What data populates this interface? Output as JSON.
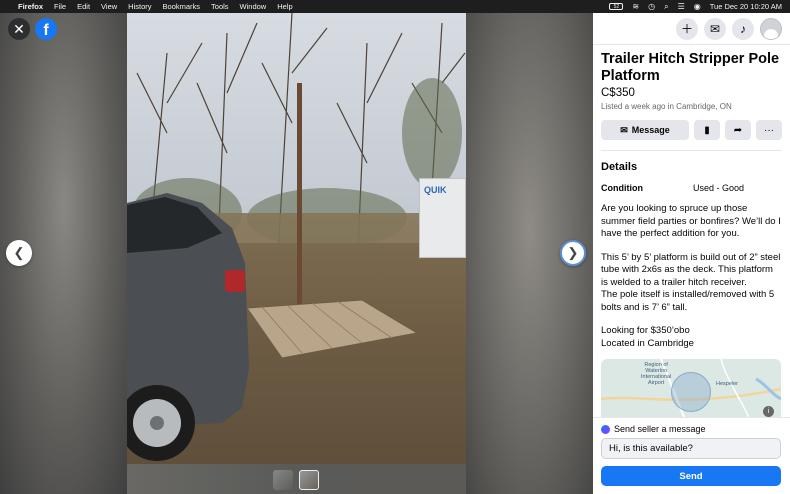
{
  "menubar": {
    "app": "Firefox",
    "menus": [
      "File",
      "Edit",
      "View",
      "History",
      "Bookmarks",
      "Tools",
      "Window",
      "Help"
    ],
    "battery": "52",
    "clock": "Tue Dec 20  10:20 AM"
  },
  "viewer": {
    "trailer_text": "QUIK",
    "thumb_count": 2,
    "active_thumb": 1
  },
  "listing": {
    "title": "Trailer Hitch Stripper Pole Platform",
    "price": "C$350",
    "listed": "Listed a week ago in Cambridge, ON",
    "message_button": "Message",
    "details_heading": "Details",
    "condition_label": "Condition",
    "condition_value": "Used - Good",
    "description": [
      "Are you looking to spruce up those summer field parties or bonfires? We’ll do I have the perfect addition for you.",
      "This 5’ by 5’ platform is build out of 2” steel tube with 2x6s as the deck. This platform is welded to a trailer hitch receiver.\nThe pole itself is installed/removed with 5 bolts and is 7’ 6” tall.",
      "Looking for $350’obo\nLocated in Cambridge"
    ]
  },
  "map": {
    "label_region": "Region of\nWaterloo\nInternational\nAirport",
    "label_town": "Hespeler"
  },
  "send": {
    "title": "Send seller a message",
    "input_value": "Hi, is this available?",
    "send_button": "Send"
  },
  "colors": {
    "brand": "#1877f2",
    "panel_bg": "#ffffff",
    "button_bg": "#e4e6eb"
  }
}
